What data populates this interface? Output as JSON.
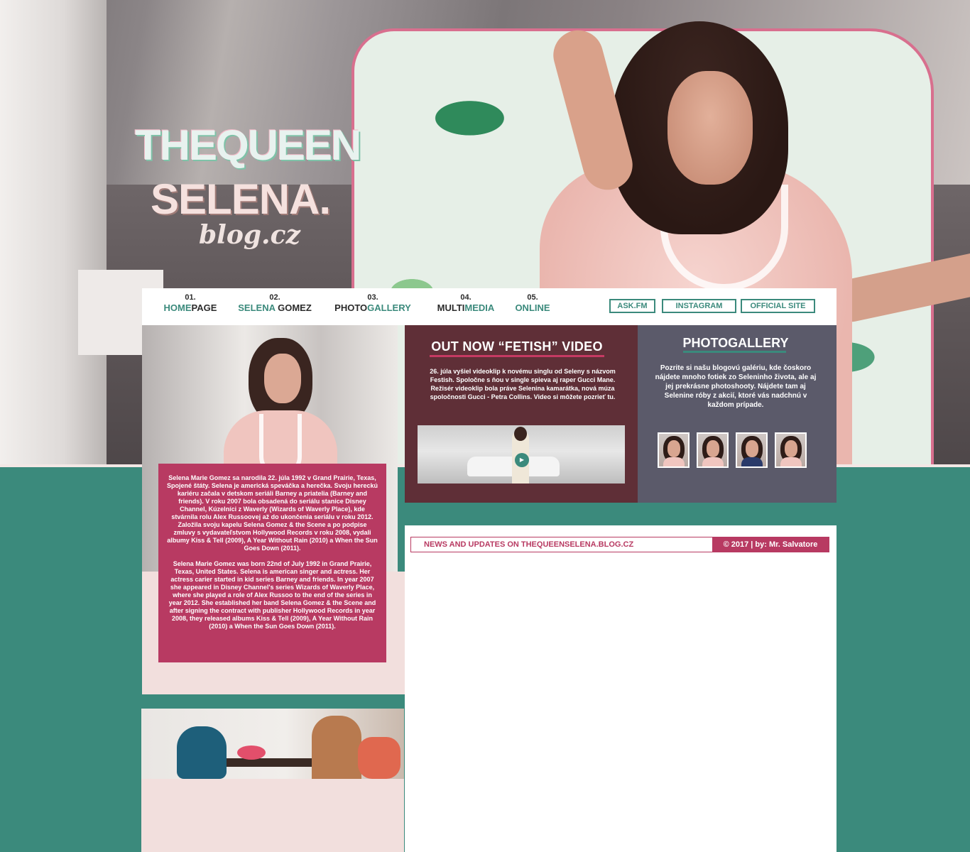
{
  "logo": {
    "line1": "THEQUEEN",
    "line2": "SELENA.",
    "sub": "blog.cz"
  },
  "nav": {
    "items": [
      {
        "num": "01.",
        "label_a": "HOME",
        "label_b": "PAGE"
      },
      {
        "num": "02.",
        "label_a": "SELENA",
        "label_b": " GOMEZ"
      },
      {
        "num": "03.",
        "label_b": "PHOTO",
        "label_a": "GALLERY"
      },
      {
        "num": "04.",
        "label_b": "MULTI",
        "label_a": "MEDIA"
      },
      {
        "num": "05.",
        "label_a": "ONLINE",
        "label_b": ""
      }
    ],
    "buttons": [
      "ASK.FM",
      "INSTAGRAM",
      "OFFICIAL SITE"
    ]
  },
  "bio": {
    "sk": "Selena Marie Gomez sa narodila 22. júla 1992 v Grand Prairie, Texas, Spojené štáty. Selena je americká speváčka a herečka. Svoju hereckú kariéru začala v detskom seriáli Barney a priatelia (Barney and friends). V roku 2007 bola obsadená do seriálu stanice Disney Channel, Kúzelníci z Waverly (Wizards of Waverly Place), kde stvárnila rolu Alex Russoovej až do ukončenia seriálu v roku 2012. Založila svoju kapelu Selena Gomez & the Scene a po podpise zmluvy s vydavateľstvom Hollywood Records v roku 2008, vydali albumy Kiss & Tell (2009), A Year Without Rain (2010) a When the Sun Goes Down (2011).",
    "en": "Selena Marie Gomez was born 22nd of July 1992 in Grand Prairie, Texas, United States. Selena is american singer and actress. Her actress carier started in kid series Barney and friends. In year 2007 she appeared in Disney Channel's series Wizards of Waverly Place, where she played a role of Alex Russoo to the end of the series in year 2012. She established her band Selena Gomez & the Scene and after signing the contract with publisher Hollywood Records in year 2008, they released albums Kiss & Tell (2009), A Year Without Rain (2010) a When the Sun Goes Down (2011)."
  },
  "news": {
    "title": "OUT NOW “FETISH” VIDEO",
    "text": "26. júla vyšiel videoklip k novému singlu od Seleny s názvom Festish. Spoločne s ňou v single spieva aj raper Gucci Mane. Režisér videoklip bola práve Selenina kamarátka, nová múza spoločnosti Gucci - Petra Collins. Video si môžete pozrieť tu."
  },
  "gallery": {
    "title": "PHOTOGALLERY",
    "text": "Pozrite si našu blogovú galériu, kde čoskoro nájdete mnoho fotiek zo Seleninho života, ale aj jej prekrásne photoshooty. Nájdete tam aj Selenine róby z akcií, ktoré vás nadchnú v každom prípade."
  },
  "footer": {
    "left": "NEWS AND UPDATES ON THEQUEENSELENA.BLOG.CZ",
    "right": "© 2017 | by: Mr. Salvatore"
  },
  "colors": {
    "teal": "#3b8a7c",
    "raspberry": "#b83a62",
    "wine": "#5f2f37",
    "slate": "#5b5a6a",
    "blush": "#f2dfdd"
  },
  "icons": {
    "play": "play-icon"
  }
}
